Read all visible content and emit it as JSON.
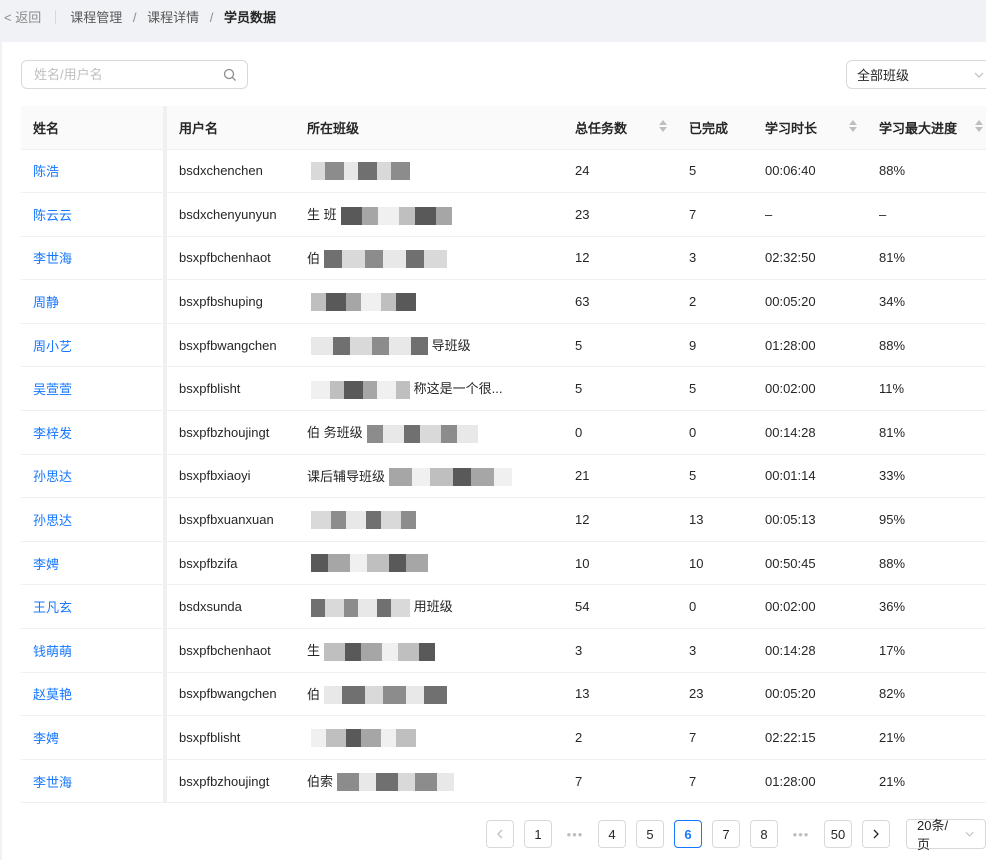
{
  "nav": {
    "back_label": "返回",
    "breadcrumb": [
      "课程管理",
      "课程详情",
      "学员数据"
    ],
    "separator": "/"
  },
  "search": {
    "placeholder": "姓名/用户名",
    "value": ""
  },
  "class_filter": {
    "selected": "全部班级"
  },
  "colors": {
    "link": "#1677ff",
    "border": "#d9d9d9",
    "header_bg": "#fafafa",
    "page_bg": "#f0f2f5"
  },
  "table": {
    "columns": [
      "姓名",
      "用户名",
      "所在班级",
      "总任务数",
      "已完成",
      "学习时长",
      "学习最大进度"
    ],
    "sortable_columns": [
      "总任务数",
      "学习时长",
      "学习最大进度"
    ],
    "rows": [
      {
        "name": "陈浩",
        "username": "bsdxchenchen",
        "class": "",
        "total": "24",
        "done": "5",
        "duration": "00:06:40",
        "progress": "88%"
      },
      {
        "name": "陈云云",
        "username": "bsdxchenyunyun",
        "class": "生                    班",
        "total": "23",
        "done": "7",
        "duration": "–",
        "progress": "–"
      },
      {
        "name": "李世海",
        "username": "bsxpfbchenhaot",
        "class": "伯",
        "total": "12",
        "done": "3",
        "duration": "02:32:50",
        "progress": "81%"
      },
      {
        "name": "周静",
        "username": "bsxpfbshuping",
        "class": "",
        "total": "63",
        "done": "2",
        "duration": "00:05:20",
        "progress": "34%"
      },
      {
        "name": "周小艺",
        "username": "bsxpfbwangchen",
        "class": "                              导班级",
        "total": "5",
        "done": "9",
        "duration": "01:28:00",
        "progress": "88%"
      },
      {
        "name": "吴萱萱",
        "username": "bsxpfblisht",
        "class": "                              称这是一个很...",
        "total": "5",
        "done": "5",
        "duration": "00:02:00",
        "progress": "11%"
      },
      {
        "name": "李梓发",
        "username": "bsxpfbzhoujingt",
        "class": "伯                            务班级",
        "total": "0",
        "done": "0",
        "duration": "00:14:28",
        "progress": "81%"
      },
      {
        "name": "孙思达",
        "username": "bsxpfbxiaoyi",
        "class": "课后辅导班级",
        "total": "21",
        "done": "5",
        "duration": "00:01:14",
        "progress": "33%"
      },
      {
        "name": "孙思达",
        "username": "bsxpfbxuanxuan",
        "class": "",
        "total": "12",
        "done": "13",
        "duration": "00:05:13",
        "progress": "95%"
      },
      {
        "name": "李娉",
        "username": "bsxpfbzifa",
        "class": "",
        "total": "10",
        "done": "10",
        "duration": "00:50:45",
        "progress": "88%"
      },
      {
        "name": "王凡玄",
        "username": "bsdxsunda",
        "class": "                              用班级",
        "total": "54",
        "done": "0",
        "duration": "00:02:00",
        "progress": "36%"
      },
      {
        "name": "钱萌萌",
        "username": "bsxpfbchenhaot",
        "class": "生",
        "total": "3",
        "done": "3",
        "duration": "00:14:28",
        "progress": "17%"
      },
      {
        "name": "赵莫艳",
        "username": "bsxpfbwangchen",
        "class": "伯",
        "total": "13",
        "done": "23",
        "duration": "00:05:20",
        "progress": "82%"
      },
      {
        "name": "李娉",
        "username": "bsxpfblisht",
        "class": "",
        "total": "2",
        "done": "7",
        "duration": "02:22:15",
        "progress": "21%"
      },
      {
        "name": "李世海",
        "username": "bsxpfbzhoujingt",
        "class": "伯索",
        "total": "7",
        "done": "7",
        "duration": "01:28:00",
        "progress": "21%"
      }
    ]
  },
  "pagination": {
    "pages": [
      "1",
      "4",
      "5",
      "6",
      "7",
      "8",
      "50"
    ],
    "current": "6",
    "ellipsis": "•••",
    "page_size": "20条/页"
  }
}
